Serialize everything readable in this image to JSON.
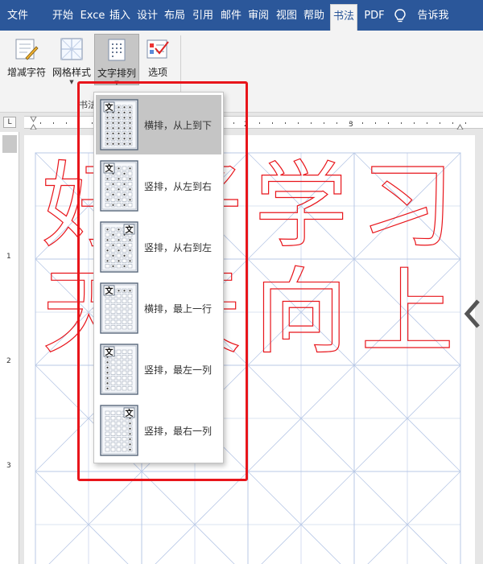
{
  "ribbon_tabs": [
    "文件",
    "开始",
    "Exce",
    "插入",
    "设计",
    "布局",
    "引用",
    "邮件",
    "审阅",
    "视图",
    "帮助",
    "书法",
    "PDF",
    "告诉我"
  ],
  "active_tab": "书法",
  "ribbon_buttons": {
    "add_remove_chars": "增减字符",
    "grid_style": "网格样式",
    "text_arrangement": "文字排列",
    "options": "选项"
  },
  "group_label": "书法",
  "ruler_numbers": [
    "1",
    "2",
    "3"
  ],
  "vruler_numbers": [
    "1",
    "2",
    "3"
  ],
  "menu": {
    "icon_glyph": "文",
    "items": [
      {
        "label": "横排，从上到下",
        "selected": true
      },
      {
        "label": "竖排，从左到右",
        "selected": false
      },
      {
        "label": "竖排，从右到左",
        "selected": false
      },
      {
        "label": "横排，最上一行",
        "selected": false
      },
      {
        "label": "竖排，最左一列",
        "selected": false
      },
      {
        "label": "竖排，最右一列",
        "selected": false
      }
    ]
  },
  "document_text": {
    "row1": [
      "好",
      "好",
      "学",
      "习"
    ],
    "row2": [
      "天",
      "天",
      "向",
      "上"
    ]
  },
  "colors": {
    "ribbon_blue": "#2b579a",
    "grid_line": "#b8c8e6",
    "outline_char": "#e8151b",
    "highlight_box": "#e8151b"
  }
}
